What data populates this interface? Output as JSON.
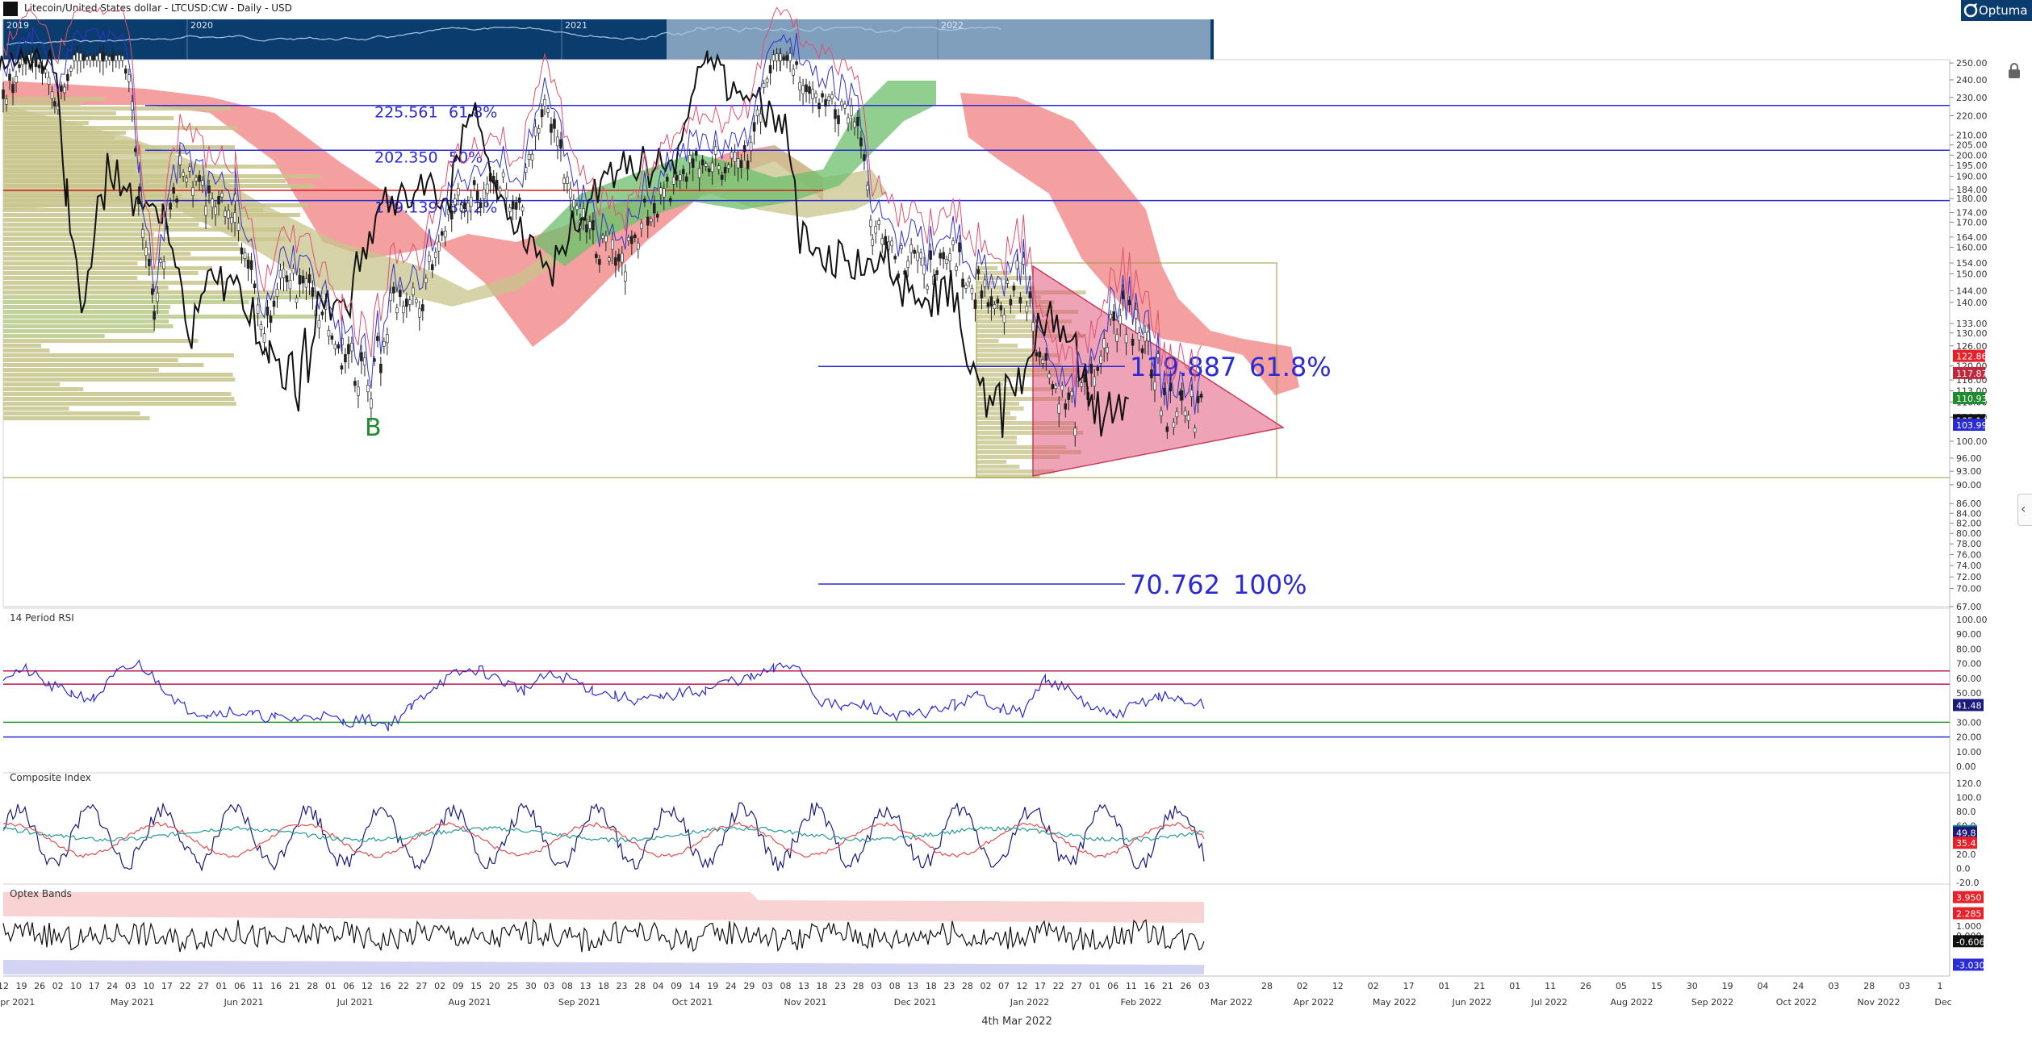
{
  "header": {
    "title": "Litecoin/United States dollar - LTCUSD:CW - Daily - USD",
    "logo_text": "Optuma"
  },
  "navigator": {
    "year_labels": [
      "2019",
      "2020",
      "2021",
      "2022"
    ]
  },
  "footer": {
    "date": "4th Mar 2022"
  },
  "main_chart": {
    "y_ticks": [
      "250.00",
      "240.00",
      "230.00",
      "220.00",
      "210.00",
      "205.00",
      "200.00",
      "195.00",
      "190.00",
      "184.00",
      "180.00",
      "174.00",
      "170.00",
      "164.00",
      "160.00",
      "154.00",
      "150.00",
      "144.00",
      "140.00",
      "133.00",
      "130.00",
      "126.00",
      "120.00",
      "116.00",
      "113.00",
      "110.00",
      "106.00",
      "100.00",
      "96.00",
      "93.00",
      "90.00",
      "86.00",
      "84.00",
      "82.00",
      "80.00",
      "78.00",
      "76.00",
      "74.00",
      "72.00",
      "70.00",
      "67.00"
    ],
    "price_badges": [
      {
        "label": "122.86",
        "color": "#e8202a"
      },
      {
        "label": "117.87",
        "color": "#c0283e"
      },
      {
        "label": "110.93",
        "color": "#1f8a2e"
      },
      {
        "label": "105.14",
        "color": "#111111"
      },
      {
        "label": "103.99",
        "color": "#2b2bd6"
      }
    ],
    "fib_levels": [
      {
        "price": "225.561",
        "pct": "61.8%"
      },
      {
        "price": "202.350",
        "pct": "50%"
      },
      {
        "price": "179.139",
        "pct": "38.2%"
      }
    ],
    "fib_big": [
      {
        "price": "119.887",
        "pct": "61.8%"
      },
      {
        "price": "70.762",
        "pct": "100%"
      }
    ],
    "wave_label": "B"
  },
  "rsi_panel": {
    "title": "14 Period RSI",
    "y_ticks": [
      "100.00",
      "90.00",
      "80.00",
      "70.00",
      "60.00",
      "50.00",
      "40.00",
      "30.00",
      "20.00",
      "10.00",
      "0.00"
    ],
    "badge": "41.48"
  },
  "composite_panel": {
    "title": "Composite Index",
    "y_ticks": [
      "120.0",
      "100.0",
      "80.0",
      "60.0",
      "40.0",
      "20.0",
      "0.0",
      "-20.0"
    ],
    "badges": [
      {
        "label": "51.9",
        "color": "#1f8a8a"
      },
      {
        "label": "49.8",
        "color": "#1a1a7a"
      },
      {
        "label": "35.4",
        "color": "#e8202a"
      }
    ]
  },
  "optex_panel": {
    "title": "Optex Bands",
    "y_ticks": [
      "1.000",
      "0.000"
    ],
    "badges": [
      {
        "label": "3.950",
        "color": "#e8202a"
      },
      {
        "label": "2.285",
        "color": "#e8202a"
      },
      {
        "label": "-0.606",
        "color": "#111111"
      },
      {
        "label": "-3.030",
        "color": "#2b2bd6"
      }
    ]
  },
  "x_axis": {
    "day_labels": [
      "12",
      "19",
      "26",
      "02",
      "10",
      "17",
      "24",
      "03",
      "10",
      "17",
      "22",
      "27",
      "01",
      "06",
      "11",
      "16",
      "21",
      "28",
      "01",
      "06",
      "12",
      "16",
      "22",
      "27",
      "02",
      "09",
      "15",
      "20",
      "25",
      "30",
      "03",
      "08",
      "13",
      "18",
      "23",
      "28",
      "04",
      "09",
      "14",
      "19",
      "24",
      "29",
      "03",
      "08",
      "13",
      "18",
      "23",
      "28",
      "03",
      "08",
      "13",
      "18",
      "23",
      "28",
      "02",
      "07",
      "12",
      "17",
      "22",
      "27",
      "01",
      "06",
      "11",
      "16",
      "21",
      "26",
      "03"
    ],
    "month_labels": [
      "Apr 2021",
      "May 2021",
      "Jun 2021",
      "Jul 2021",
      "Aug 2021",
      "Sep 2021",
      "Oct 2021",
      "Nov 2021",
      "Dec 2021",
      "Jan 2022",
      "Feb 2022",
      "Mar 2022",
      "Apr 2022",
      "May 2022",
      "Jun 2022",
      "Jul 2022",
      "Aug 2022",
      "Sep 2022",
      "Oct 2022",
      "Nov 2022",
      "Dec"
    ],
    "future_day_labels": [
      "28",
      "02",
      "12",
      "02",
      "17",
      "01",
      "21",
      "01",
      "11",
      "26",
      "05",
      "15",
      "30",
      "19",
      "04",
      "24",
      "03",
      "28",
      "03",
      "1"
    ]
  },
  "chart_data": [
    {
      "type": "line",
      "panel": "main",
      "title": "Litecoin/United States dollar - LTCUSD:CW - Daily - USD",
      "yscale": "log",
      "ylim": [
        67,
        252
      ],
      "x_range": [
        "2021-04-12",
        "2022-03-04"
      ],
      "series": [],
      "close_approx": [
        [
          "2021-04-12",
          228
        ],
        [
          "2021-04-20",
          255
        ],
        [
          "2021-04-26",
          225
        ],
        [
          "2021-05-03",
          265
        ],
        [
          "2021-05-10",
          350
        ],
        [
          "2021-05-19",
          180
        ],
        [
          "2021-05-23",
          140
        ],
        [
          "2021-05-30",
          190
        ],
        [
          "2021-06-06",
          180
        ],
        [
          "2021-06-14",
          175
        ],
        [
          "2021-06-21",
          130
        ],
        [
          "2021-06-28",
          150
        ],
        [
          "2021-07-05",
          140
        ],
        [
          "2021-07-13",
          126
        ],
        [
          "2021-07-20",
          112
        ],
        [
          "2021-07-27",
          138
        ],
        [
          "2021-08-03",
          140
        ],
        [
          "2021-08-10",
          170
        ],
        [
          "2021-08-17",
          180
        ],
        [
          "2021-08-24",
          185
        ],
        [
          "2021-08-31",
          178
        ],
        [
          "2021-09-06",
          230
        ],
        [
          "2021-09-13",
          180
        ],
        [
          "2021-09-20",
          160
        ],
        [
          "2021-09-27",
          150
        ],
        [
          "2021-10-04",
          175
        ],
        [
          "2021-10-11",
          185
        ],
        [
          "2021-10-18",
          195
        ],
        [
          "2021-10-25",
          195
        ],
        [
          "2021-11-01",
          200
        ],
        [
          "2021-11-09",
          270
        ],
        [
          "2021-11-16",
          230
        ],
        [
          "2021-11-23",
          225
        ],
        [
          "2021-11-30",
          215
        ],
        [
          "2021-12-04",
          165
        ],
        [
          "2021-12-11",
          155
        ],
        [
          "2021-12-18",
          150
        ],
        [
          "2021-12-25",
          158
        ],
        [
          "2021-12-31",
          146
        ],
        [
          "2022-01-07",
          138
        ],
        [
          "2022-01-14",
          148
        ],
        [
          "2022-01-21",
          112
        ],
        [
          "2022-01-28",
          108
        ],
        [
          "2022-02-04",
          125
        ],
        [
          "2022-02-10",
          135
        ],
        [
          "2022-02-16",
          128
        ],
        [
          "2022-02-22",
          108
        ],
        [
          "2022-02-26",
          112
        ],
        [
          "2022-03-04",
          105.14
        ]
      ],
      "fibonacci": [
        {
          "level": "61.8%",
          "price": 225.561
        },
        {
          "level": "50%",
          "price": 202.35
        },
        {
          "level": "38.2%",
          "price": 179.139
        },
        {
          "level": "61.8%",
          "price": 119.887
        },
        {
          "level": "100%",
          "price": 70.762
        }
      ],
      "current_values": [
        122.86,
        117.87,
        110.93,
        105.14,
        103.99
      ],
      "grid": false
    },
    {
      "type": "line",
      "panel": "rsi",
      "title": "14 Period RSI",
      "ylim": [
        0,
        100
      ],
      "levels": [
        65,
        56,
        30,
        20
      ],
      "last": 41.48,
      "values_approx": [
        62,
        66,
        55,
        50,
        46,
        63,
        70,
        55,
        40,
        36,
        38,
        35,
        33,
        32,
        35,
        30,
        32,
        28,
        40,
        55,
        63,
        66,
        58,
        52,
        62,
        60,
        52,
        48,
        45,
        46,
        50,
        52,
        58,
        60,
        66,
        70,
        45,
        40,
        42,
        36,
        34,
        38,
        42,
        48,
        40,
        36,
        60,
        52,
        40,
        34,
        42,
        48,
        45,
        41.48
      ]
    },
    {
      "type": "line",
      "panel": "composite",
      "title": "Composite Index",
      "ylim": [
        -20,
        130
      ],
      "last": [
        51.9,
        49.8,
        35.4
      ]
    },
    {
      "type": "line",
      "panel": "optex",
      "title": "Optex Bands",
      "last": [
        3.95,
        2.285,
        -0.606,
        -3.03
      ]
    }
  ]
}
